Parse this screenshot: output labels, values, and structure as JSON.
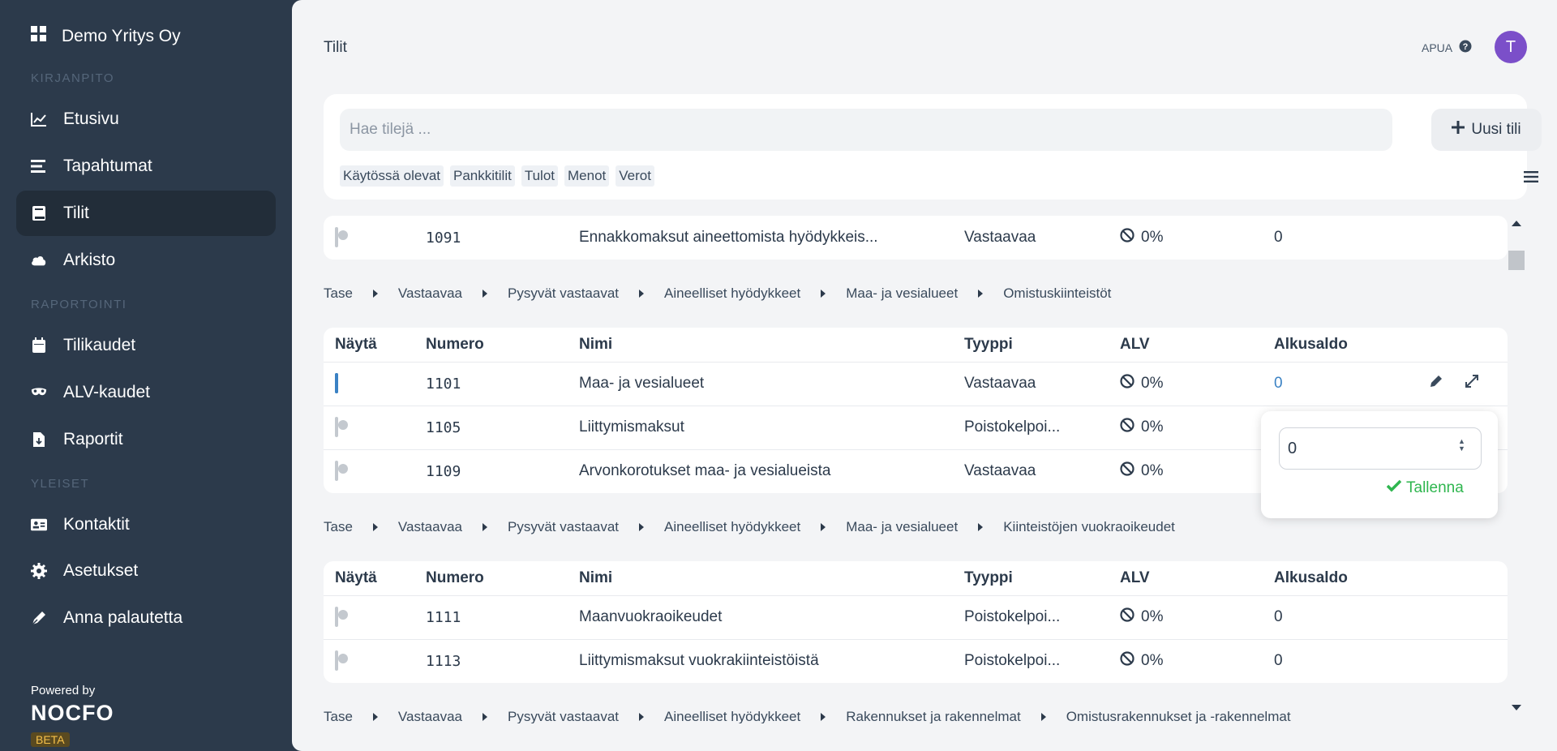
{
  "sidebar": {
    "company": "Demo Yritys Oy",
    "sections": {
      "kirjanpito": "KIRJANPITO",
      "raportointi": "RAPORTOINTI",
      "yleiset": "YLEISET"
    },
    "items": {
      "etusivu": "Etusivu",
      "tapahtumat": "Tapahtumat",
      "tilit": "Tilit",
      "arkisto": "Arkisto",
      "tilikaudet": "Tilikaudet",
      "alvkaudet": "ALV-kaudet",
      "raportit": "Raportit",
      "kontaktit": "Kontaktit",
      "asetukset": "Asetukset",
      "palaute": "Anna palautetta"
    },
    "powered_by": "Powered by",
    "logo": "NOCFO",
    "beta": "BETA"
  },
  "header": {
    "title": "Tilit",
    "help": "APUA",
    "avatar_initial": "T"
  },
  "search": {
    "placeholder": "Hae tilejä ...",
    "new_button": "Uusi tili",
    "filters": [
      "Käytössä olevat",
      "Pankkitilit",
      "Tulot",
      "Menot",
      "Verot"
    ]
  },
  "columns": {
    "show": "Näytä",
    "number": "Numero",
    "name": "Nimi",
    "type": "Tyyppi",
    "vat": "ALV",
    "opening": "Alkusaldo"
  },
  "top_row": {
    "number": "1091",
    "name": "Ennakkomaksut aineettomista hyödykkeis...",
    "type": "Vastaavaa",
    "vat": "0%",
    "opening": "0"
  },
  "groups": [
    {
      "breadcrumb": [
        "Tase",
        "Vastaavaa",
        "Pysyvät vastaavat",
        "Aineelliset hyödykkeet",
        "Maa- ja vesialueet",
        "Omistuskiinteistöt"
      ],
      "rows": [
        {
          "number": "1101",
          "name": "Maa- ja vesialueet",
          "type": "Vastaavaa",
          "vat": "0%",
          "opening": "0"
        },
        {
          "number": "1105",
          "name": "Liittymismaksut",
          "type": "Poistokelpoi...",
          "vat": "0%",
          "opening": ""
        },
        {
          "number": "1109",
          "name": "Arvonkorotukset maa- ja vesialueista",
          "type": "Vastaavaa",
          "vat": "0%",
          "opening": ""
        }
      ]
    },
    {
      "breadcrumb": [
        "Tase",
        "Vastaavaa",
        "Pysyvät vastaavat",
        "Aineelliset hyödykkeet",
        "Maa- ja vesialueet",
        "Kiinteistöjen vuokraoikeudet"
      ],
      "rows": [
        {
          "number": "1111",
          "name": "Maanvuokraoikeudet",
          "type": "Poistokelpoi...",
          "vat": "0%",
          "opening": "0"
        },
        {
          "number": "1113",
          "name": "Liittymismaksut vuokrakiinteistöistä",
          "type": "Poistokelpoi...",
          "vat": "0%",
          "opening": "0"
        }
      ]
    }
  ],
  "bottom_breadcrumb": [
    "Tase",
    "Vastaavaa",
    "Pysyvät vastaavat",
    "Aineelliset hyödykkeet",
    "Rakennukset ja rakennelmat",
    "Omistusrakennukset ja -rakennelmat"
  ],
  "popover": {
    "value": "0",
    "save": "Tallenna"
  },
  "colors": {
    "sidebar": "#2c3a4b",
    "accent": "#3b82c4",
    "save": "#2fb64f",
    "avatar": "#7b4fc9"
  }
}
